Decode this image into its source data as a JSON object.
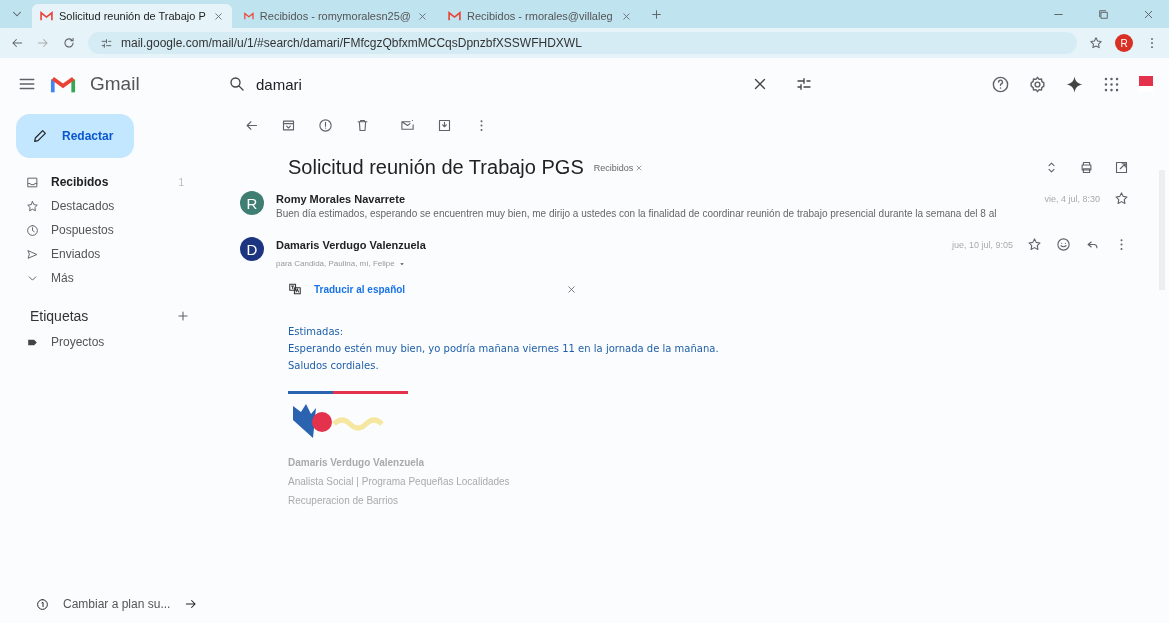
{
  "browser": {
    "tabs": [
      {
        "title": "Solicitud reunión de Trabajo P",
        "selected": true
      },
      {
        "title": "Recibidos - romymoralesn25@",
        "selected": false
      },
      {
        "title": "Recibidos - rmorales@villaleg",
        "selected": false
      }
    ],
    "url": "mail.google.com/mail/u/1/#search/damari/FMfcgzQbfxmMCCqsDpnzbfXSSWFHDXWL",
    "profile_initial": "R"
  },
  "app": {
    "name": "Gmail",
    "search_value": "damari"
  },
  "compose_label": "Redactar",
  "sidebar": {
    "items": [
      {
        "kind": "inbox",
        "label": "Recibidos",
        "count": "1",
        "selected": true
      },
      {
        "kind": "star",
        "label": "Destacados",
        "selected": false
      },
      {
        "kind": "clock",
        "label": "Pospuestos",
        "selected": false
      },
      {
        "kind": "send",
        "label": "Enviados",
        "selected": false
      },
      {
        "kind": "more",
        "label": "Más",
        "selected": false
      }
    ],
    "labels_heading": "Etiquetas",
    "labels": [
      {
        "label": "Proyectos"
      }
    ],
    "upgrade": "Cambiar a plan su..."
  },
  "thread": {
    "subject": "Solicitud reunión de Trabajo PGS",
    "tag": "Recibidos",
    "messages": [
      {
        "initial": "R",
        "color": "#3f7f73",
        "sender": "Romy Morales Navarrete",
        "snippet": "Buen día estimados, esperando se encuentren muy bien, me dirijo a ustedes con la finalidad de coordinar reunión de trabajo presencial durante la semana del 8 al",
        "date": "vie, 4 jul, 8:30",
        "expanded": false
      },
      {
        "initial": "D",
        "color": "#1d3580",
        "sender": "Damaris Verdugo Valenzuela",
        "recipients": "para Candida, Paulina, mí, Felipe",
        "date": "jue, 10 jul, 9:05",
        "expanded": true,
        "translate": "Traducir al español",
        "body": [
          "Estimadas:",
          "Esperando estén muy bien, yo podría mañana viernes 11 en la jornada de la mañana.",
          "Saludos cordiales."
        ],
        "signature": [
          "Damaris Verdugo Valenzuela",
          "Analista Social | Programa Pequeñas Localidades",
          "Recuperacion de Barrios"
        ]
      }
    ]
  }
}
